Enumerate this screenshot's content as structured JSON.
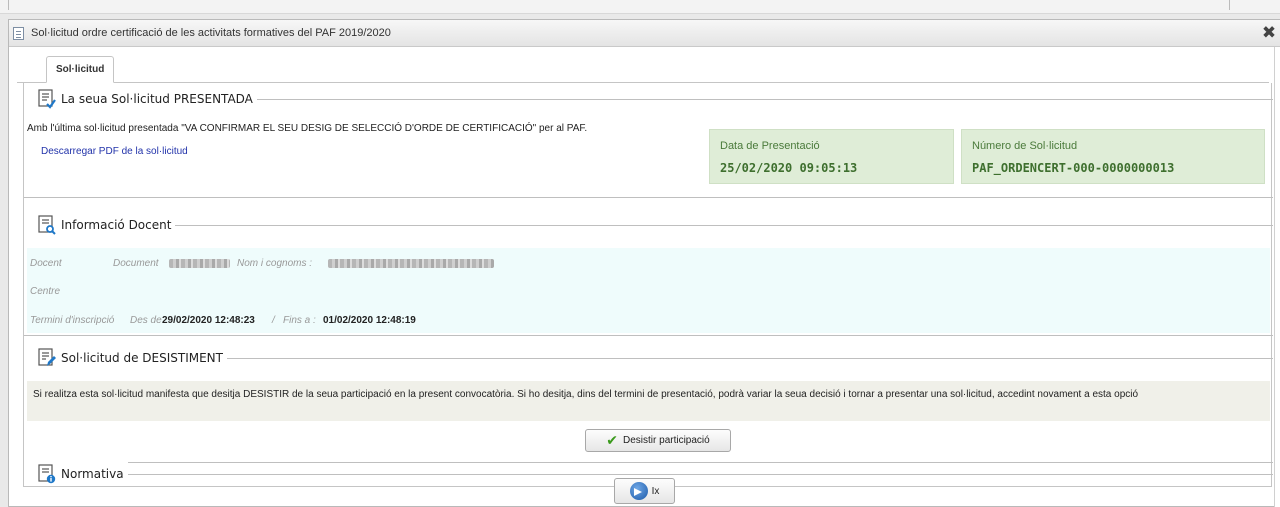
{
  "window": {
    "title": "Sol·licitud ordre certificació de les activitats formatives del PAF 2019/2020",
    "close_label": "✖"
  },
  "tabs": [
    {
      "label": "Sol·licitud",
      "active": true
    }
  ],
  "presented": {
    "legend": "La seua Sol·licitud PRESENTADA",
    "message": "Amb l'última sol·licitud presentada \"VA CONFIRMAR EL SEU DESIG DE SELECCIÓ D'ORDE DE CERTIFICACIÓ\" per al PAF.",
    "pdf_link": "Descarregar PDF de la sol·licitud",
    "date_label": "Data de Presentació",
    "date_value": "25/02/2020 09:05:13",
    "number_label": "Número de Sol·licitud",
    "number_value": "PAF_ORDENCERT-000-0000000013"
  },
  "teacher": {
    "legend": "Informació Docent",
    "docent_label": "Docent",
    "document_label": "Document",
    "name_label": "Nom i cognoms :",
    "centre_label": "Centre",
    "period_label": "Termini d'inscripció",
    "from_label": "Des de :",
    "from_value": "29/02/2020 12:48:23",
    "separator": "/",
    "to_label": "Fins a :",
    "to_value": "01/02/2020 12:48:19"
  },
  "withdrawal": {
    "legend": "Sol·licitud de DESISTIMENT",
    "text": "Si realitza esta sol·licitud manifesta que desitja DESISTIR de la seua participació en la present convocatòria. Si ho desitja, dins del termini de presentació, podrà variar la seua decisió i tornar a presentar una sol·licitud, accedint novament a esta opció",
    "button_label": "Desistir participació",
    "button_icon": "check-icon"
  },
  "regulations": {
    "legend": "Normativa"
  },
  "footer": {
    "exit_label": "Ix",
    "exit_icon": "arrow-right-icon"
  },
  "colors": {
    "green_box": "#dfedd7",
    "green_text": "#3e6f2e",
    "info_bg": "#effcfc",
    "link": "#2233aa"
  }
}
